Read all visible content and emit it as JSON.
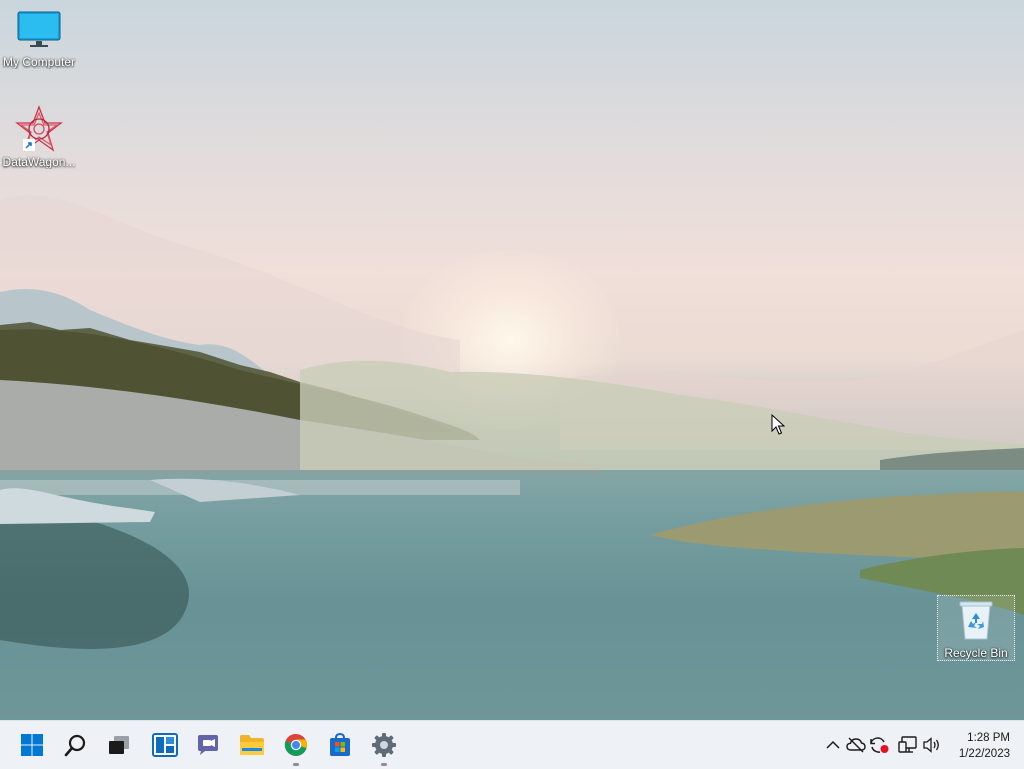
{
  "desktop": {
    "icons": [
      {
        "label": "My Computer",
        "icon": "monitor-icon"
      },
      {
        "label": "DataWagon...",
        "icon": "datawagon-app-icon",
        "shortcut": true
      },
      {
        "label": "Recycle Bin",
        "icon": "recycle-bin-icon",
        "selected": true
      }
    ]
  },
  "taskbar": {
    "pinned": [
      {
        "name": "start-button",
        "icon": "windows-logo-icon"
      },
      {
        "name": "search-button",
        "icon": "search-icon"
      },
      {
        "name": "task-view-button",
        "icon": "task-view-icon"
      },
      {
        "name": "widgets-button",
        "icon": "widgets-icon"
      },
      {
        "name": "chat-button",
        "icon": "teams-chat-icon"
      },
      {
        "name": "file-explorer-button",
        "icon": "folder-icon"
      },
      {
        "name": "chrome-button",
        "icon": "chrome-icon",
        "running": true
      },
      {
        "name": "store-button",
        "icon": "store-icon"
      },
      {
        "name": "settings-button",
        "icon": "gear-icon",
        "running": true
      }
    ],
    "tray": [
      "chevron-up-icon",
      "cloud-off-icon",
      "sync-alert-icon",
      "network-icon",
      "volume-icon"
    ],
    "clock": {
      "time": "1:28 PM",
      "date": "1/22/2023"
    }
  },
  "colors": {
    "taskbar_bg": "#eef1f5",
    "windows_blue": "#0078d4",
    "alert_red": "#e81123"
  }
}
